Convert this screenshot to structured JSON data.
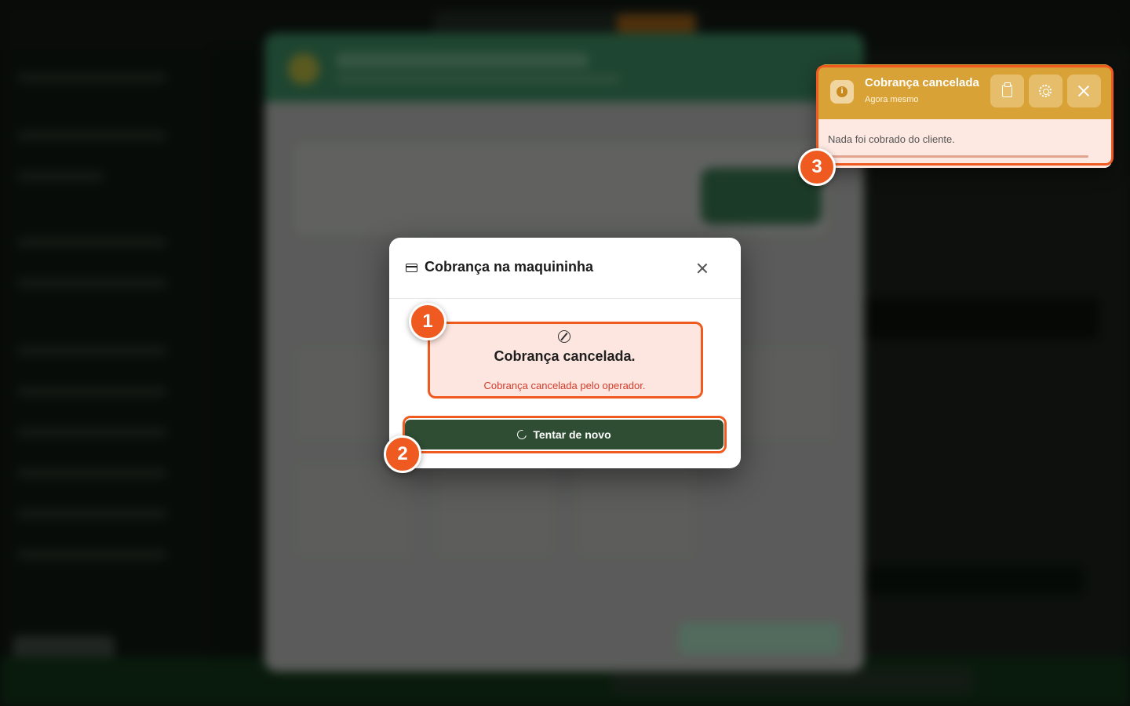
{
  "modal": {
    "title": "Cobrança na maquininha",
    "icon": "credit-card-icon",
    "status_title": "Cobrança cancelada.",
    "status_message": "Cobrança cancelada pelo operador.",
    "status_icon": "ban-icon",
    "retry_label": "Tentar de novo",
    "retry_icon": "refresh-icon"
  },
  "toast": {
    "title": "Cobrança cancelada",
    "time": "Agora mesmo",
    "message": "Nada foi cobrado do cliente.",
    "icon": "info-icon",
    "actions": [
      "clipboard-icon",
      "gear-icon",
      "close-icon"
    ],
    "progress_fraction": 0.92
  },
  "annotations": [
    "1",
    "2",
    "3"
  ],
  "colors": {
    "accent": "#ee5a1f",
    "retry_button": "#2e4d33",
    "toast_header": "#d9a236",
    "error_bg": "#fde6e0",
    "error_text": "#d43a2a"
  }
}
